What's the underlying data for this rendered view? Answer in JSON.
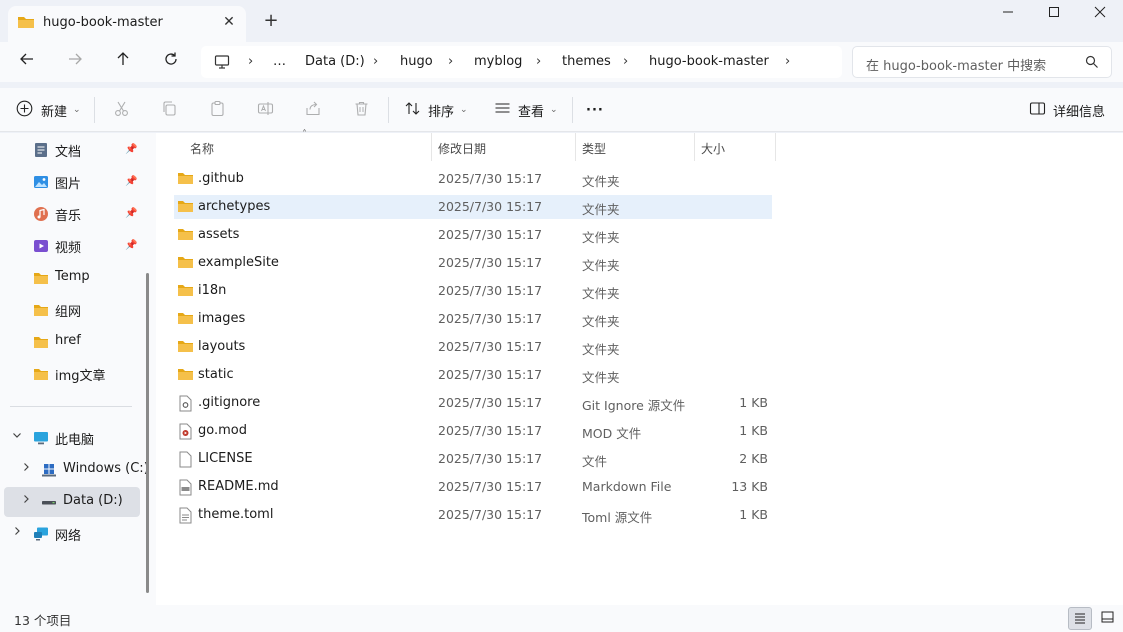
{
  "window": {
    "tab_title": "hugo-book-master",
    "new_tab": "+",
    "minimize": "—",
    "maximize": "☐",
    "close": "✕"
  },
  "nav": {
    "breadcrumbs": [
      "…",
      "Data (D:)",
      "hugo",
      "myblog",
      "themes",
      "hugo-book-master"
    ],
    "search_placeholder": "在 hugo-book-master 中搜索"
  },
  "toolbar": {
    "new_label": "新建",
    "sort_label": "排序",
    "view_label": "查看",
    "more_label": "···",
    "details_label": "详细信息"
  },
  "sidebar": {
    "quick_access": [
      {
        "label": "文档",
        "icon": "documents-icon",
        "pinned": true
      },
      {
        "label": "图片",
        "icon": "pictures-icon",
        "pinned": true
      },
      {
        "label": "音乐",
        "icon": "music-icon",
        "pinned": true
      },
      {
        "label": "视频",
        "icon": "videos-icon",
        "pinned": true
      },
      {
        "label": "Temp",
        "icon": "folder-icon",
        "pinned": false
      },
      {
        "label": "组网",
        "icon": "folder-icon",
        "pinned": false
      },
      {
        "label": "href",
        "icon": "folder-icon",
        "pinned": false
      },
      {
        "label": "img文章",
        "icon": "folder-icon",
        "pinned": false
      }
    ],
    "this_pc": "此电脑",
    "drive_c": "Windows (C:)",
    "drive_d": "Data (D:)",
    "network": "网络"
  },
  "columns": {
    "name": "名称",
    "date": "修改日期",
    "type": "类型",
    "size": "大小"
  },
  "files": [
    {
      "name": ".github",
      "date": "2025/7/30 15:17",
      "type": "文件夹",
      "size": "",
      "icon": "folder-icon"
    },
    {
      "name": "archetypes",
      "date": "2025/7/30 15:17",
      "type": "文件夹",
      "size": "",
      "icon": "folder-icon"
    },
    {
      "name": "assets",
      "date": "2025/7/30 15:17",
      "type": "文件夹",
      "size": "",
      "icon": "folder-icon"
    },
    {
      "name": "exampleSite",
      "date": "2025/7/30 15:17",
      "type": "文件夹",
      "size": "",
      "icon": "folder-icon"
    },
    {
      "name": "i18n",
      "date": "2025/7/30 15:17",
      "type": "文件夹",
      "size": "",
      "icon": "folder-icon"
    },
    {
      "name": "images",
      "date": "2025/7/30 15:17",
      "type": "文件夹",
      "size": "",
      "icon": "folder-icon"
    },
    {
      "name": "layouts",
      "date": "2025/7/30 15:17",
      "type": "文件夹",
      "size": "",
      "icon": "folder-icon"
    },
    {
      "name": "static",
      "date": "2025/7/30 15:17",
      "type": "文件夹",
      "size": "",
      "icon": "folder-icon"
    },
    {
      "name": ".gitignore",
      "date": "2025/7/30 15:17",
      "type": "Git Ignore 源文件",
      "size": "1 KB",
      "icon": "config-file-icon"
    },
    {
      "name": "go.mod",
      "date": "2025/7/30 15:17",
      "type": "MOD 文件",
      "size": "1 KB",
      "icon": "media-file-icon"
    },
    {
      "name": "LICENSE",
      "date": "2025/7/30 15:17",
      "type": "文件",
      "size": "2 KB",
      "icon": "blank-file-icon"
    },
    {
      "name": "README.md",
      "date": "2025/7/30 15:17",
      "type": "Markdown File",
      "size": "13 KB",
      "icon": "markdown-file-icon"
    },
    {
      "name": "theme.toml",
      "date": "2025/7/30 15:17",
      "type": "Toml 源文件",
      "size": "1 KB",
      "icon": "text-file-icon"
    }
  ],
  "status": {
    "item_count": "13 个项目"
  },
  "colors": {
    "folder": "#f5c04a",
    "folder_dark": "#e6a817",
    "selection": "#e6f0fb",
    "accent": "#0067c0"
  }
}
